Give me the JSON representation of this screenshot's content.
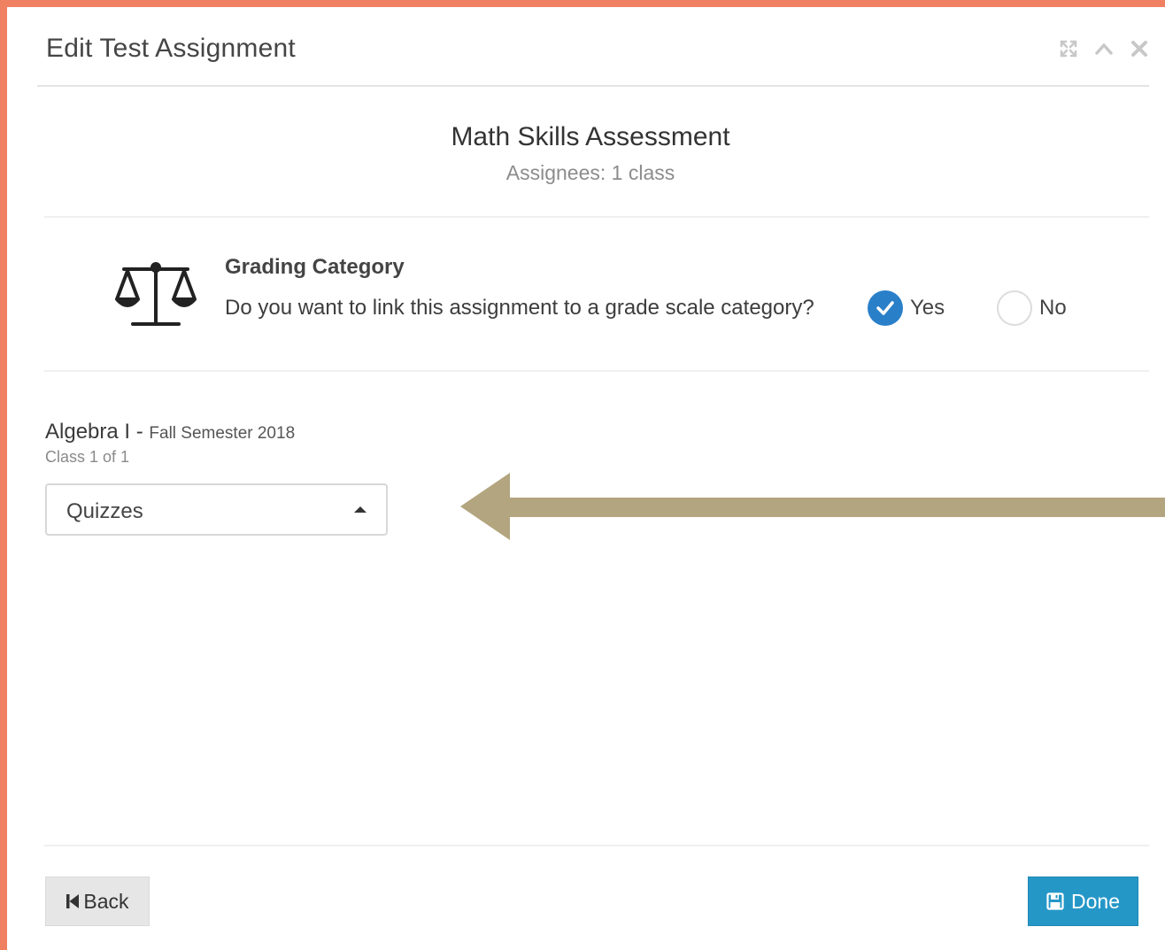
{
  "window": {
    "title": "Edit Test Assignment",
    "controls": [
      {
        "icon": "expand-icon"
      },
      {
        "icon": "collapse-chevron-up-icon"
      },
      {
        "icon": "close-icon"
      }
    ]
  },
  "assignment": {
    "name": "Math Skills Assessment",
    "assignees": "Assignees: 1 class"
  },
  "grading": {
    "icon": "scale-icon",
    "heading": "Grading Category",
    "question": "Do you want to link this assignment to a grade scale category?",
    "options": [
      {
        "label": "Yes",
        "selected": true
      },
      {
        "label": "No",
        "selected": false
      }
    ]
  },
  "class": {
    "name": "Algebra I",
    "separator": " - ",
    "semester": "Fall Semester 2018",
    "count": "Class 1 of 1",
    "category_select": {
      "value": "Quizzes"
    }
  },
  "annotation": {
    "arrow_color": "#b3a57f"
  },
  "footer": {
    "back_label": "Back",
    "done_label": "Done"
  },
  "colors": {
    "page_border": "#f08062",
    "accent_blue": "#2597c7",
    "radio_checked": "#2a7fc9"
  }
}
